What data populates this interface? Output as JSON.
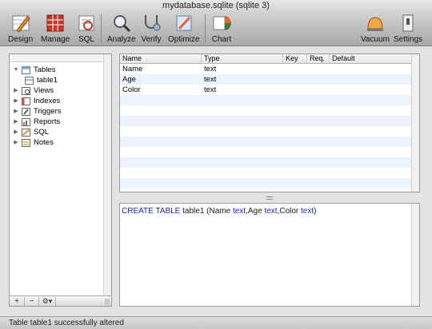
{
  "window": {
    "title": "mydatabase.sqlite (sqlite 3)"
  },
  "toolbar": {
    "buttons": [
      {
        "label": "Design",
        "icon": "design-icon"
      },
      {
        "label": "Manage",
        "icon": "manage-icon"
      },
      {
        "label": "SQL",
        "icon": "sql-icon"
      },
      {
        "label": "Analyze",
        "icon": "analyze-icon"
      },
      {
        "label": "Verify",
        "icon": "verify-icon"
      },
      {
        "label": "Optimize",
        "icon": "optimize-icon"
      },
      {
        "label": "Chart",
        "icon": "chart-icon"
      },
      {
        "label": "Vacuum",
        "icon": "vacuum-icon"
      },
      {
        "label": "Settings",
        "icon": "settings-icon"
      }
    ]
  },
  "sidebar": {
    "items": [
      {
        "label": "Tables",
        "expanded": true,
        "icon": "tables-icon"
      },
      {
        "label": "table1",
        "child": true,
        "icon": "table-icon"
      },
      {
        "label": "Views",
        "icon": "views-icon"
      },
      {
        "label": "Indexes",
        "icon": "indexes-icon"
      },
      {
        "label": "Triggers",
        "icon": "triggers-icon"
      },
      {
        "label": "Reports",
        "icon": "reports-icon"
      },
      {
        "label": "SQL",
        "icon": "sql-item-icon"
      },
      {
        "label": "Notes",
        "icon": "notes-icon"
      }
    ],
    "footer": {
      "add": "+",
      "remove": "−",
      "action": "⚙▾"
    }
  },
  "columns_table": {
    "headers": [
      "Name",
      "Type",
      "Key",
      "Req.",
      "Default"
    ],
    "rows": [
      [
        "Name",
        "text",
        "",
        "",
        ""
      ],
      [
        "Age",
        "text",
        "",
        "",
        ""
      ],
      [
        "Color",
        "text",
        "",
        "",
        ""
      ]
    ]
  },
  "sql": {
    "kw1": "CREATE TABLE",
    "part1": " table1 (Name ",
    "kw2": "text",
    "part2": ",Age ",
    "kw3": "text",
    "part3": ",Color ",
    "kw4": "text",
    "part4": ")"
  },
  "status": {
    "text": "Table table1 successfully altered"
  },
  "colors": {
    "keyword": "#1a27b4",
    "row_alt": "#edf3fe"
  }
}
